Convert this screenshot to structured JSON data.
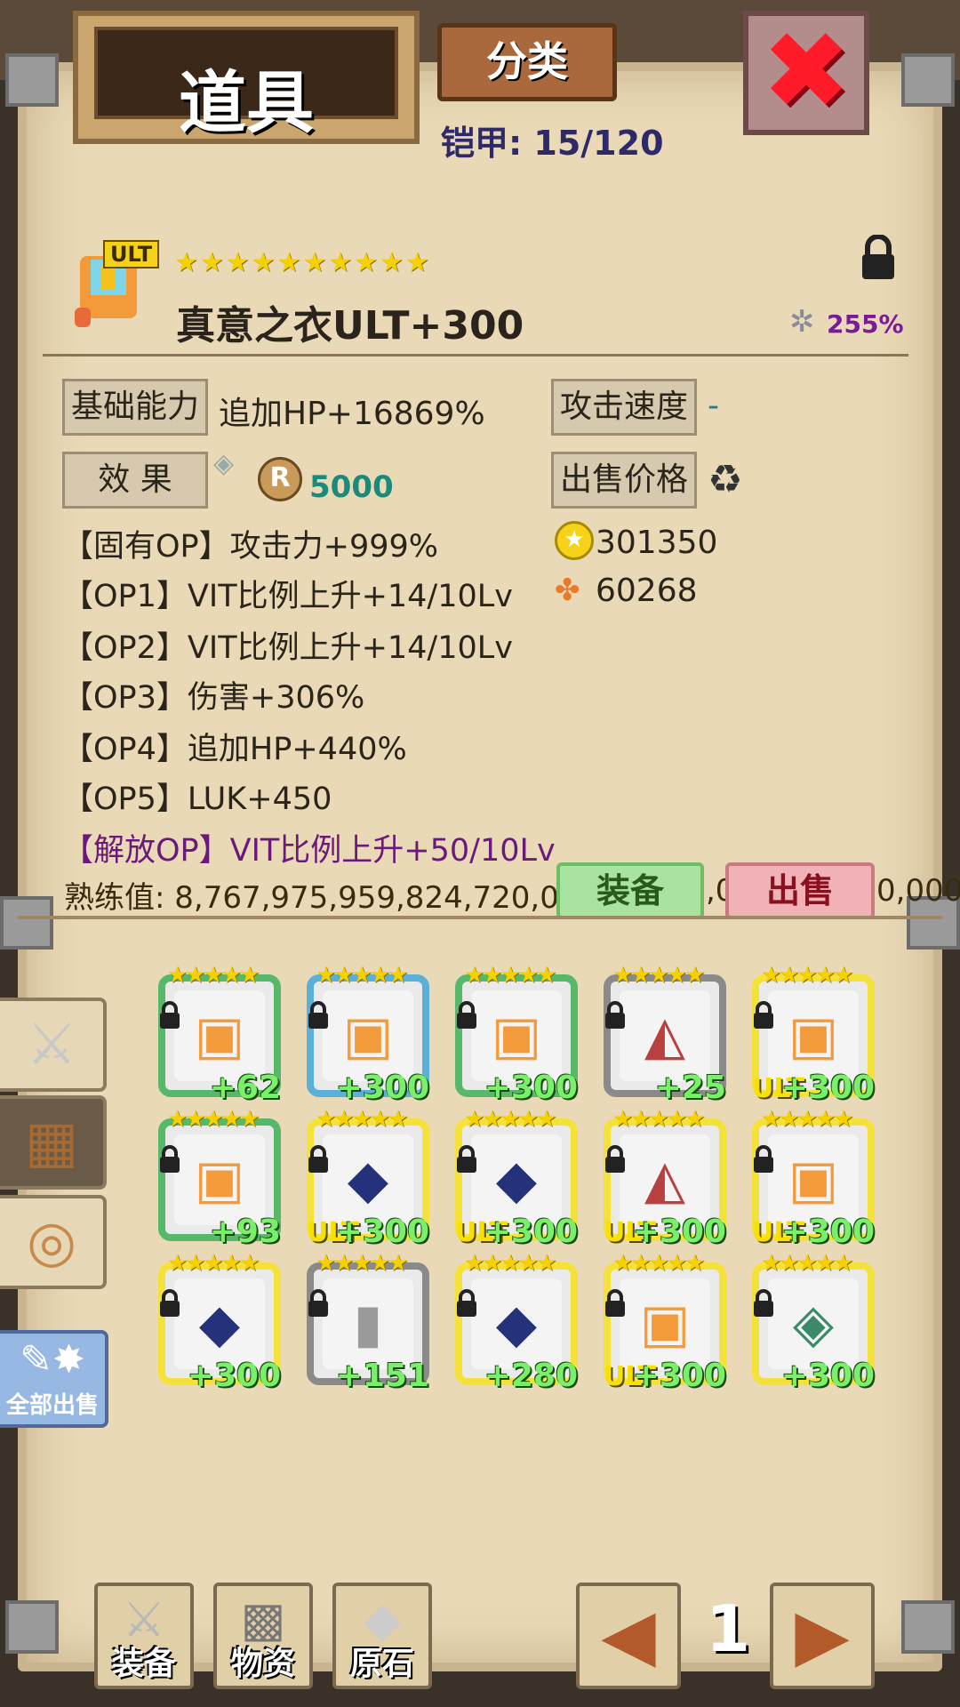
{
  "header": {
    "title": "道具",
    "sort_label": "分类",
    "close_icon": "close-x-icon",
    "armor_count": "铠甲: 15/120"
  },
  "item": {
    "badge": "ULT",
    "stars": "★★★★★★★★★★",
    "name": "真意之衣ULT+300",
    "lock_icon": "lock-icon",
    "percent": "255%",
    "base_label": "基础能力",
    "base_value": "追加HP+16869%",
    "speed_label": "攻击速度",
    "speed_value": "-",
    "effect_label": "效 果",
    "effect_value": "5000",
    "sell_label": "出售价格",
    "gold_value": "301350",
    "material_value": "60268",
    "lines": [
      "【固有OP】攻击力+999%",
      "【OP1】VIT比例上升+14/10Lv",
      "【OP2】VIT比例上升+14/10Lv",
      "【OP3】伤害+306%",
      "【OP4】追加HP+440%",
      "【OP5】LUK+450",
      "【解放OP】VIT比例上升+50/10Lv"
    ],
    "proficiency": "熟练值: 8,767,975,959,824,720,00",
    "proficiency_tail": ",0",
    "proficiency_tail2": "0,000,",
    "equip_label": "装备",
    "sell_button": "出售"
  },
  "sidebar": {
    "tabs": [
      "weapon-sword-icon",
      "armor-vest-icon",
      "ring-icon"
    ],
    "sell_all": "全部出售"
  },
  "grid": [
    {
      "lvl": "+62",
      "ult": "",
      "frame": "#58b86a",
      "icon": "armor-icon"
    },
    {
      "lvl": "+300",
      "ult": "",
      "frame": "#5ab0d8",
      "icon": "armor-icon"
    },
    {
      "lvl": "+300",
      "ult": "",
      "frame": "#58b86a",
      "icon": "armor-icon"
    },
    {
      "lvl": "+25",
      "ult": "",
      "frame": "#8a8a8a",
      "icon": "cape-icon"
    },
    {
      "lvl": "+300",
      "ult": "ULT",
      "frame": "#f4e23a",
      "icon": "armor-icon"
    },
    {
      "lvl": "+93",
      "ult": "",
      "frame": "#58b86a",
      "icon": "armor-icon"
    },
    {
      "lvl": "+300",
      "ult": "ULT",
      "frame": "#f4e23a",
      "icon": "dark-robe-icon"
    },
    {
      "lvl": "+300",
      "ult": "ULT",
      "frame": "#f4e23a",
      "icon": "dark-robe-icon"
    },
    {
      "lvl": "+300",
      "ult": "ULT",
      "frame": "#f4e23a",
      "icon": "cape-icon"
    },
    {
      "lvl": "+300",
      "ult": "ULT",
      "frame": "#f4e23a",
      "icon": "armor-icon"
    },
    {
      "lvl": "+300",
      "ult": "",
      "frame": "#f4e23a",
      "icon": "dark-robe-icon"
    },
    {
      "lvl": "+151",
      "ult": "",
      "frame": "#8a8a8a",
      "icon": "plate-armor-icon"
    },
    {
      "lvl": "+280",
      "ult": "",
      "frame": "#f4e23a",
      "icon": "dark-robe-icon"
    },
    {
      "lvl": "+300",
      "ult": "ULT",
      "frame": "#f4e23a",
      "icon": "armor-icon"
    },
    {
      "lvl": "+300",
      "ult": "",
      "frame": "#f4e23a",
      "icon": "green-armor-icon"
    }
  ],
  "bottom": {
    "nav": [
      "装备",
      "物资",
      "原石"
    ],
    "page": "1"
  }
}
